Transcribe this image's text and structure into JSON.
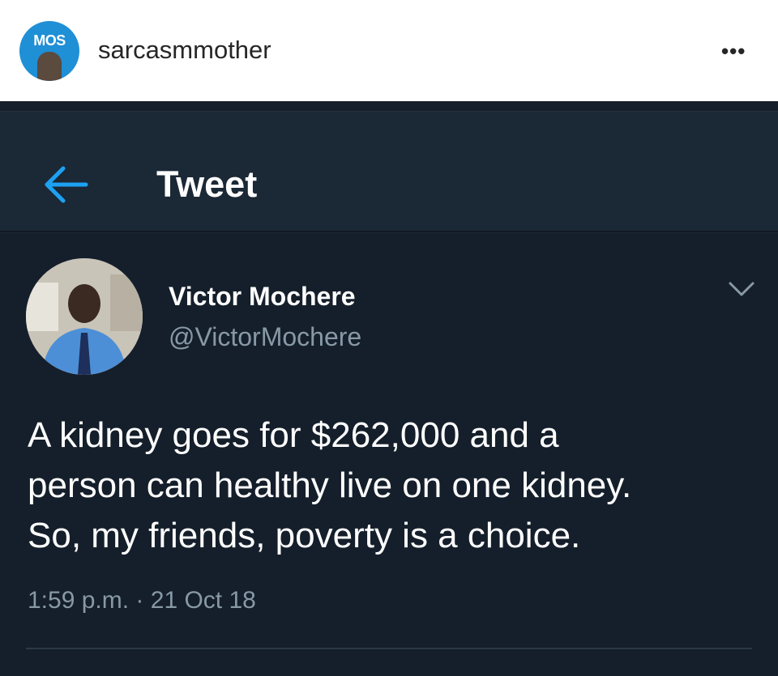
{
  "instagram": {
    "username": "sarcasmmother",
    "avatar_text": "MOS",
    "more_label": "•••"
  },
  "twitter_bar": {
    "title": "Tweet",
    "back_icon": "arrow-left-icon"
  },
  "tweet": {
    "author_name": "Victor Mochere",
    "handle": "@VictorMochere",
    "text_lines": [
      "A kidney goes for $262,000 and a",
      "person can healthy live on one kidney.",
      "So, my friends, poverty is a choice."
    ],
    "time": "1:59 p.m.",
    "separator": "·",
    "date": "21 Oct 18"
  },
  "colors": {
    "background": "#151f2b",
    "bar": "#1b2836",
    "accent": "#1da1f2",
    "muted": "#8899a6"
  }
}
